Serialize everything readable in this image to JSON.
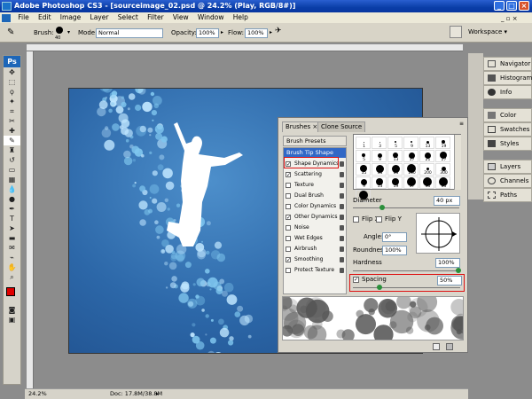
{
  "window": {
    "title": "Adobe Photoshop CS3 - [sourceimage_02.psd @ 24.2% (Play, RGB/8#)]"
  },
  "menu": [
    "File",
    "Edit",
    "Image",
    "Layer",
    "Select",
    "Filter",
    "View",
    "Window",
    "Help"
  ],
  "options": {
    "brush_label": "Brush:",
    "brush_size": "40",
    "mode_label": "Mode:",
    "mode_value": "Normal",
    "opacity_label": "Opacity:",
    "opacity_value": "100%",
    "flow_label": "Flow:",
    "flow_value": "100%",
    "workspace_label": "Workspace"
  },
  "toolbox": {
    "logo": "Ps"
  },
  "status": {
    "zoom": "24.2%",
    "doc": "Doc: 17.8M/38.8M"
  },
  "dock": {
    "items": [
      "Navigator",
      "Histogram",
      "Info",
      "Color",
      "Swatches",
      "Styles",
      "Layers",
      "Channels",
      "Paths"
    ]
  },
  "brushes": {
    "tabs": [
      "Brushes",
      "Clone Source"
    ],
    "brush_presets": "Brush Presets",
    "brush_tip_shape": "Brush Tip Shape",
    "options": [
      {
        "label": "Shape Dynamics",
        "checked": true
      },
      {
        "label": "Scattering",
        "checked": true
      },
      {
        "label": "Texture",
        "checked": false
      },
      {
        "label": "Dual Brush",
        "checked": false
      },
      {
        "label": "Color Dynamics",
        "checked": false
      },
      {
        "label": "Other Dynamics",
        "checked": true
      },
      {
        "label": "Noise",
        "checked": false
      },
      {
        "label": "Wet Edges",
        "checked": false
      },
      {
        "label": "Airbrush",
        "checked": false
      },
      {
        "label": "Smoothing",
        "checked": true
      },
      {
        "label": "Protect Texture",
        "checked": false
      }
    ],
    "preset_sizes": [
      "1",
      "3",
      "5",
      "9",
      "13",
      "19",
      "5",
      "9",
      "13",
      "17",
      "21",
      "27",
      "35",
      "45",
      "65",
      "100",
      "200",
      "300",
      "9",
      "13",
      "19",
      "17",
      "45",
      "65",
      "100"
    ],
    "diameter_label": "Diameter",
    "diameter_value": "40 px",
    "flipx_label": "Flip X",
    "flipy_label": "Flip Y",
    "angle_label": "Angle:",
    "angle_value": "0°",
    "roundness_label": "Roundness:",
    "roundness_value": "100%",
    "hardness_label": "Hardness",
    "hardness_value": "100%",
    "spacing_label": "Spacing",
    "spacing_value": "50%",
    "flip_x_checked": false,
    "flip_y_checked": false,
    "spacing_checked": true
  },
  "colors": {
    "foreground": "#e00000",
    "background": "#ffffff",
    "accent": "#0a3ea8",
    "highlight": "#d11a1a"
  }
}
